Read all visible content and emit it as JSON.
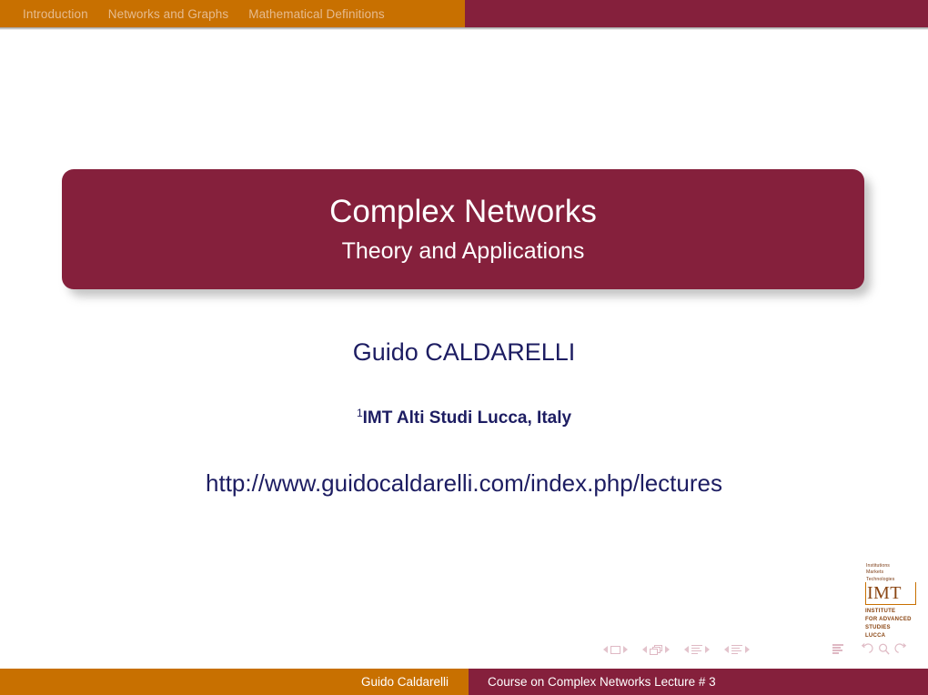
{
  "header": {
    "sections": [
      {
        "label": "Introduction"
      },
      {
        "label": "Networks and Graphs"
      },
      {
        "label": "Mathematical Definitions"
      }
    ]
  },
  "title_block": {
    "title": "Complex Networks",
    "subtitle": "Theory and Applications"
  },
  "author_block": {
    "author": "Guido CALDARELLI",
    "affiliation_marker": "1",
    "affiliation": "IMT Alti Studi Lucca, Italy",
    "url": "http://www.guidocaldarelli.com/index.php/lectures"
  },
  "logo": {
    "tagline": [
      "Institutions",
      "Markets",
      "Technologies"
    ],
    "mark": "IMT",
    "lines": [
      "INSTITUTE",
      "FOR ADVANCED",
      "STUDIES",
      "LUCCA"
    ]
  },
  "navigation": {
    "groups": [
      {
        "icon": "slide-icon"
      },
      {
        "icon": "frames-icon"
      },
      {
        "icon": "subsection-icon"
      },
      {
        "icon": "section-icon"
      }
    ],
    "back_group": {
      "doc_icon": "document-icon",
      "back_icon": "undo-arrow-icon",
      "search_icon": "search-icon",
      "forward_icon": "redo-arrow-icon"
    }
  },
  "footer": {
    "author": "Guido Caldarelli",
    "course": "Course on Complex Networks Lecture # 3"
  },
  "colors": {
    "orange": "#c87000",
    "maroon": "#85203c",
    "navy": "#1d1d62",
    "header_text": "#e6bb8e"
  }
}
